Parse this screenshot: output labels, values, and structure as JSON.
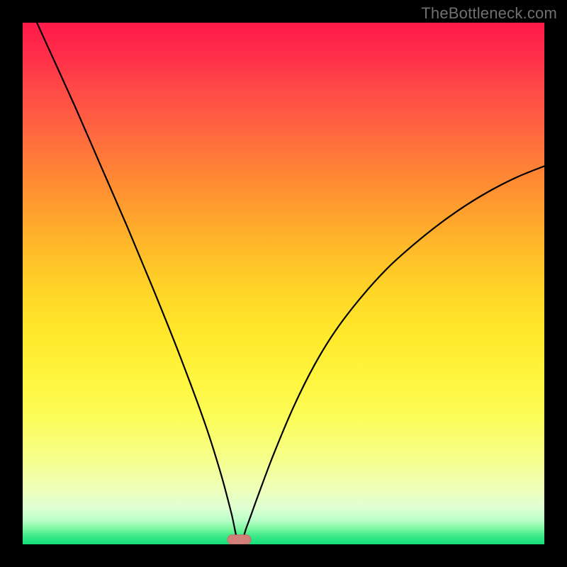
{
  "watermark": "TheBottleneck.com",
  "colors": {
    "frame": "#000000",
    "curve": "#000000",
    "marker_fill": "#d08078",
    "marker_stroke": "#c07068"
  },
  "chart_data": {
    "type": "line",
    "title": "",
    "xlabel": "",
    "ylabel": "",
    "xlim": [
      0,
      100
    ],
    "ylim": [
      0,
      100
    ],
    "minimum_marker": {
      "x": 41.5,
      "width": 4.5,
      "height_pct": 1.8
    },
    "series": [
      {
        "name": "bottleneck-curve",
        "x": [
          0,
          5,
          10,
          15,
          20,
          25,
          30,
          35,
          38,
          40,
          41.5,
          43,
          45,
          48,
          52,
          56,
          60,
          65,
          70,
          75,
          80,
          85,
          90,
          95,
          100
        ],
        "values": [
          106,
          95,
          84,
          72.5,
          61,
          49,
          36.5,
          23,
          13.5,
          6,
          0,
          3.5,
          9,
          17,
          26.5,
          34.5,
          41,
          47.5,
          53,
          57.5,
          61.5,
          65,
          68,
          70.5,
          72.5
        ]
      }
    ]
  }
}
